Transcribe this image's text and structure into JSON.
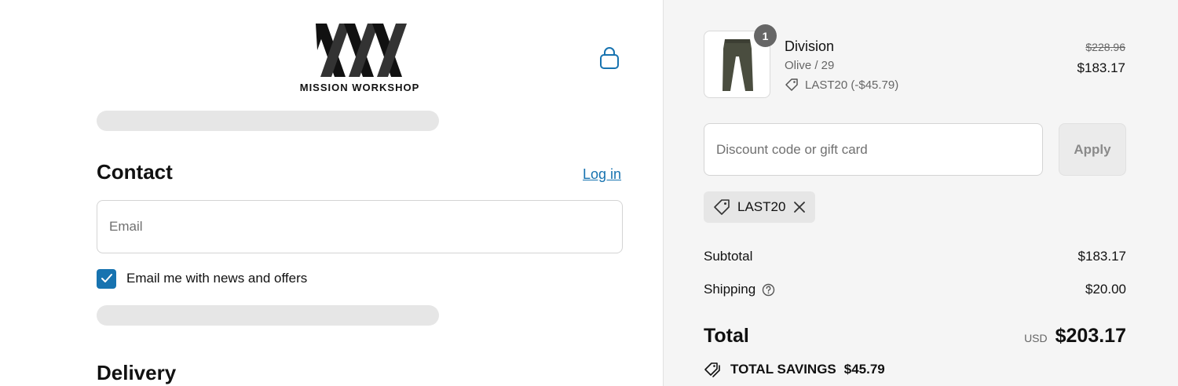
{
  "brand": {
    "name": "MISSION WORKSHOP"
  },
  "icons": {
    "cart": "shopping-bag-icon",
    "check": "checkmark-icon",
    "tag": "tag-icon",
    "close": "close-icon",
    "help": "help-circle-icon",
    "savings": "tags-icon"
  },
  "colors": {
    "accent": "#1773b0",
    "panel_bg": "#f5f5f5"
  },
  "contact": {
    "title": "Contact",
    "login_label": "Log in",
    "email_placeholder": "Email",
    "email_value": "",
    "newsletter_label": "Email me with news and offers",
    "newsletter_checked": true
  },
  "delivery": {
    "title": "Delivery"
  },
  "order": {
    "item": {
      "name": "Division",
      "variant": "Olive / 29",
      "discount": "LAST20 (-$45.79)",
      "quantity": "1",
      "original_price": "$228.96",
      "price": "$183.17"
    },
    "discount_field": {
      "placeholder": "Discount code or gift card",
      "value": "",
      "apply_label": "Apply"
    },
    "applied_code": "LAST20",
    "summary": {
      "subtotal_label": "Subtotal",
      "subtotal_value": "$183.17",
      "shipping_label": "Shipping",
      "shipping_value": "$20.00",
      "total_label": "Total",
      "currency": "USD",
      "total_value": "$203.17",
      "savings_label": "TOTAL SAVINGS",
      "savings_value": "$45.79"
    }
  }
}
